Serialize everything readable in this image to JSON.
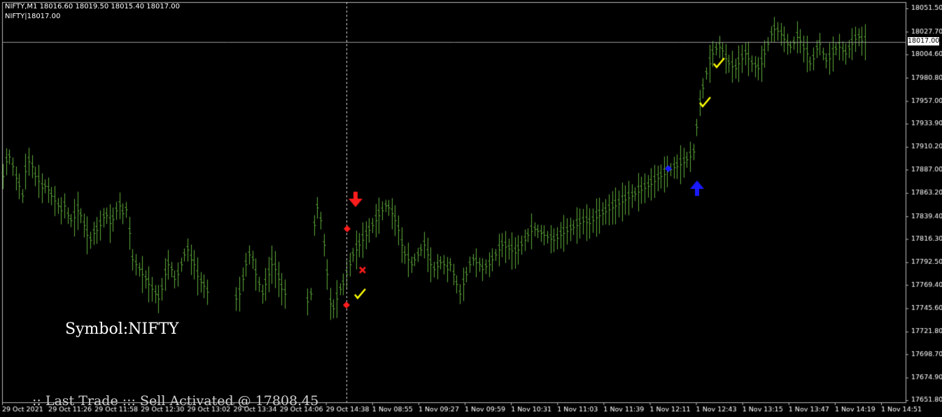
{
  "header": {
    "line1": "NIFTY,M1  18016.60 18019.50 18015.40 18017.00",
    "line2": "NIFTY|18017.00"
  },
  "labels": {
    "symbol": "Symbol:NIFTY",
    "last_trade": ":: Last Trade ::: Sell Activated @ 17808.45"
  },
  "current_price": "18017.00",
  "colors": {
    "background": "#000000",
    "bars": "#5fae3a",
    "grid": "#9a9a9a",
    "sell_arrow": "#ff1c1c",
    "buy_arrow": "#1a1aff",
    "check": "#ffff00",
    "cross": "#ff1c1c",
    "diamond_red": "#ff1c1c",
    "diamond_blue": "#1a1aff"
  },
  "chart_data": {
    "type": "ohlc",
    "symbol": "NIFTY",
    "timeframe": "M1",
    "ylim": [
      17651.8,
      18051.5
    ],
    "y_ticks": [
      "18051.50",
      "18027.70",
      "18004.60",
      "17980.80",
      "17957.00",
      "17933.90",
      "17910.20",
      "17887.00",
      "17863.20",
      "17839.40",
      "17816.30",
      "17792.50",
      "17769.40",
      "17745.60",
      "17721.80",
      "17698.70",
      "17674.90",
      "17651.80"
    ],
    "x_ticks": [
      "29 Oct 2021",
      "29 Oct 11:26",
      "29 Oct 11:58",
      "29 Oct 12:30",
      "29 Oct 13:02",
      "29 Oct 13:34",
      "29 Oct 14:06",
      "29 Oct 14:38",
      "1 Nov 08:55",
      "1 Nov 09:27",
      "1 Nov 09:59",
      "1 Nov 10:31",
      "1 Nov 11:03",
      "1 Nov 11:39",
      "1 Nov 12:11",
      "1 Nov 12:43",
      "1 Nov 13:15",
      "1 Nov 13:47",
      "1 Nov 14:19",
      "1 Nov 14:51"
    ],
    "close_series": [
      17880,
      17895,
      17900,
      17890,
      17878,
      17870,
      17860,
      17885,
      17895,
      17890,
      17880,
      17875,
      17868,
      17870,
      17866,
      17860,
      17855,
      17850,
      17845,
      17850,
      17840,
      17835,
      17838,
      17845,
      17840,
      17830,
      17820,
      17815,
      17822,
      17825,
      17830,
      17838,
      17840,
      17832,
      17836,
      17845,
      17850,
      17842,
      17846,
      17822,
      17795,
      17790,
      17785,
      17780,
      17775,
      17770,
      17765,
      17760,
      17755,
      17765,
      17780,
      17790,
      17785,
      17775,
      17780,
      17790,
      17800,
      17805,
      17795,
      17790,
      17778,
      17772,
      17768,
      17762,
      null,
      null,
      null,
      null,
      null,
      null,
      null,
      null,
      17755,
      17760,
      17775,
      17790,
      17800,
      17795,
      17780,
      17770,
      17760,
      17770,
      17780,
      17790,
      17785,
      17775,
      17765,
      17760,
      null,
      null,
      null,
      null,
      null,
      null,
      17752,
      17760,
      17830,
      17848,
      17835,
      17810,
      17780,
      17750,
      17745,
      17755,
      17765,
      17770,
      17780,
      17790,
      17800,
      17805,
      17810,
      17815,
      17820,
      17825,
      17830,
      17835,
      17840,
      17845,
      17850,
      17848,
      17842,
      17835,
      17825,
      17810,
      17800,
      17795,
      17790,
      17795,
      17800,
      17805,
      17810,
      17800,
      17790,
      17785,
      17788,
      17792,
      17790,
      17785,
      17790,
      17780,
      17770,
      17760,
      17770,
      17780,
      17790,
      17795,
      17792,
      17790,
      17785,
      17788,
      17790,
      17795,
      17800,
      17805,
      17810,
      17808,
      17806,
      17804,
      17802,
      17805,
      17810,
      17815,
      17820,
      17824,
      17826,
      17824,
      17822,
      17820,
      17818,
      17816,
      17815,
      17817,
      17820,
      17822,
      17824,
      17826,
      17828,
      17830,
      17832,
      17834,
      17833,
      17832,
      17835,
      17838,
      17840,
      17842,
      17844,
      17846,
      17848,
      17850,
      17852,
      17854,
      17856,
      17858,
      17860,
      17862,
      17864,
      17866,
      17868,
      17870,
      17872,
      17875,
      17878,
      17880,
      17882,
      17885,
      17887,
      17889,
      17890,
      17892,
      17894,
      17897,
      17900,
      17905,
      17930,
      17955,
      17970,
      17985,
      17995,
      18005,
      18010,
      18012,
      18008,
      18000,
      17995,
      17992,
      17990,
      17995,
      18000,
      18005,
      18000,
      17995,
      17992,
      17990,
      17995,
      18005,
      18015,
      18025,
      18030,
      18028,
      18025,
      18020,
      18015,
      18012,
      18016,
      18022,
      18018,
      18010,
      18005,
      17995,
      18000,
      18010,
      18015,
      18005,
      17998,
      18000,
      18005,
      18010,
      18012,
      18008,
      18005,
      18010,
      18015,
      18020,
      18022,
      18018,
      18017
    ]
  }
}
